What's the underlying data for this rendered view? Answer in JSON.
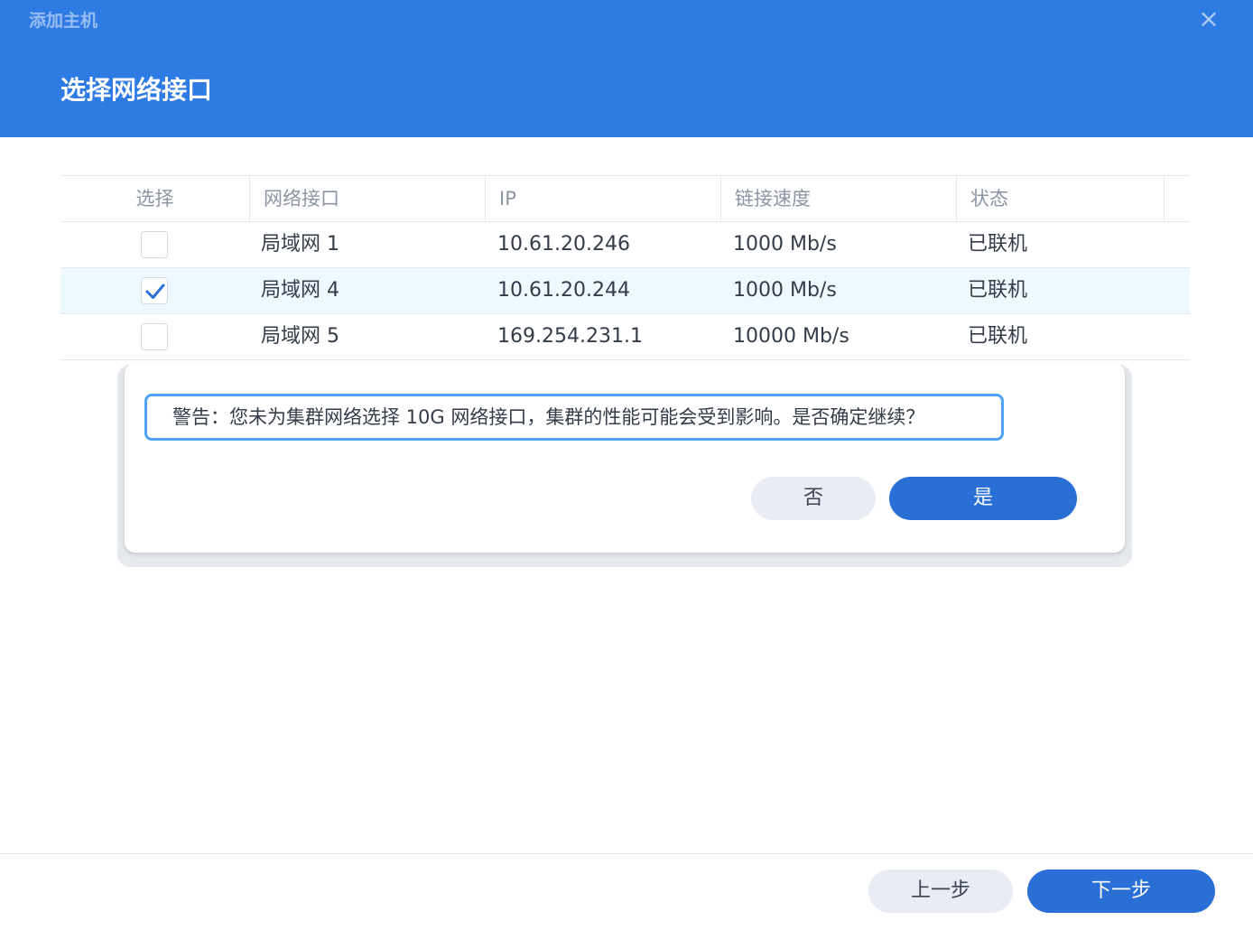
{
  "window": {
    "title": "添加主机",
    "close_icon": "×"
  },
  "step": {
    "title": "选择网络接口"
  },
  "table": {
    "columns": [
      "选择",
      "网络接口",
      "IP",
      "链接速度",
      "状态"
    ],
    "rows": [
      {
        "selected": false,
        "interface": "局域网 1",
        "ip": "10.61.20.246",
        "speed": "1000 Mb/s",
        "status": "已联机"
      },
      {
        "selected": true,
        "interface": "局域网 4",
        "ip": "10.61.20.244",
        "speed": "1000 Mb/s",
        "status": "已联机"
      },
      {
        "selected": false,
        "interface": "局域网 5",
        "ip": "169.254.231.1",
        "speed": "10000 Mb/s",
        "status": "已联机"
      }
    ]
  },
  "dialog": {
    "message": "警告：您未为集群网络选择 10G 网络接口，集群的性能可能会受到影响。是否确定继续？",
    "no_label": "否",
    "yes_label": "是"
  },
  "footer": {
    "prev_label": "上一步",
    "next_label": "下一步"
  },
  "colors": {
    "header": "#2f7be4",
    "primary": "#2a6fd6",
    "selected_row": "#edf8ff",
    "warning_border": "#4da3f5"
  }
}
